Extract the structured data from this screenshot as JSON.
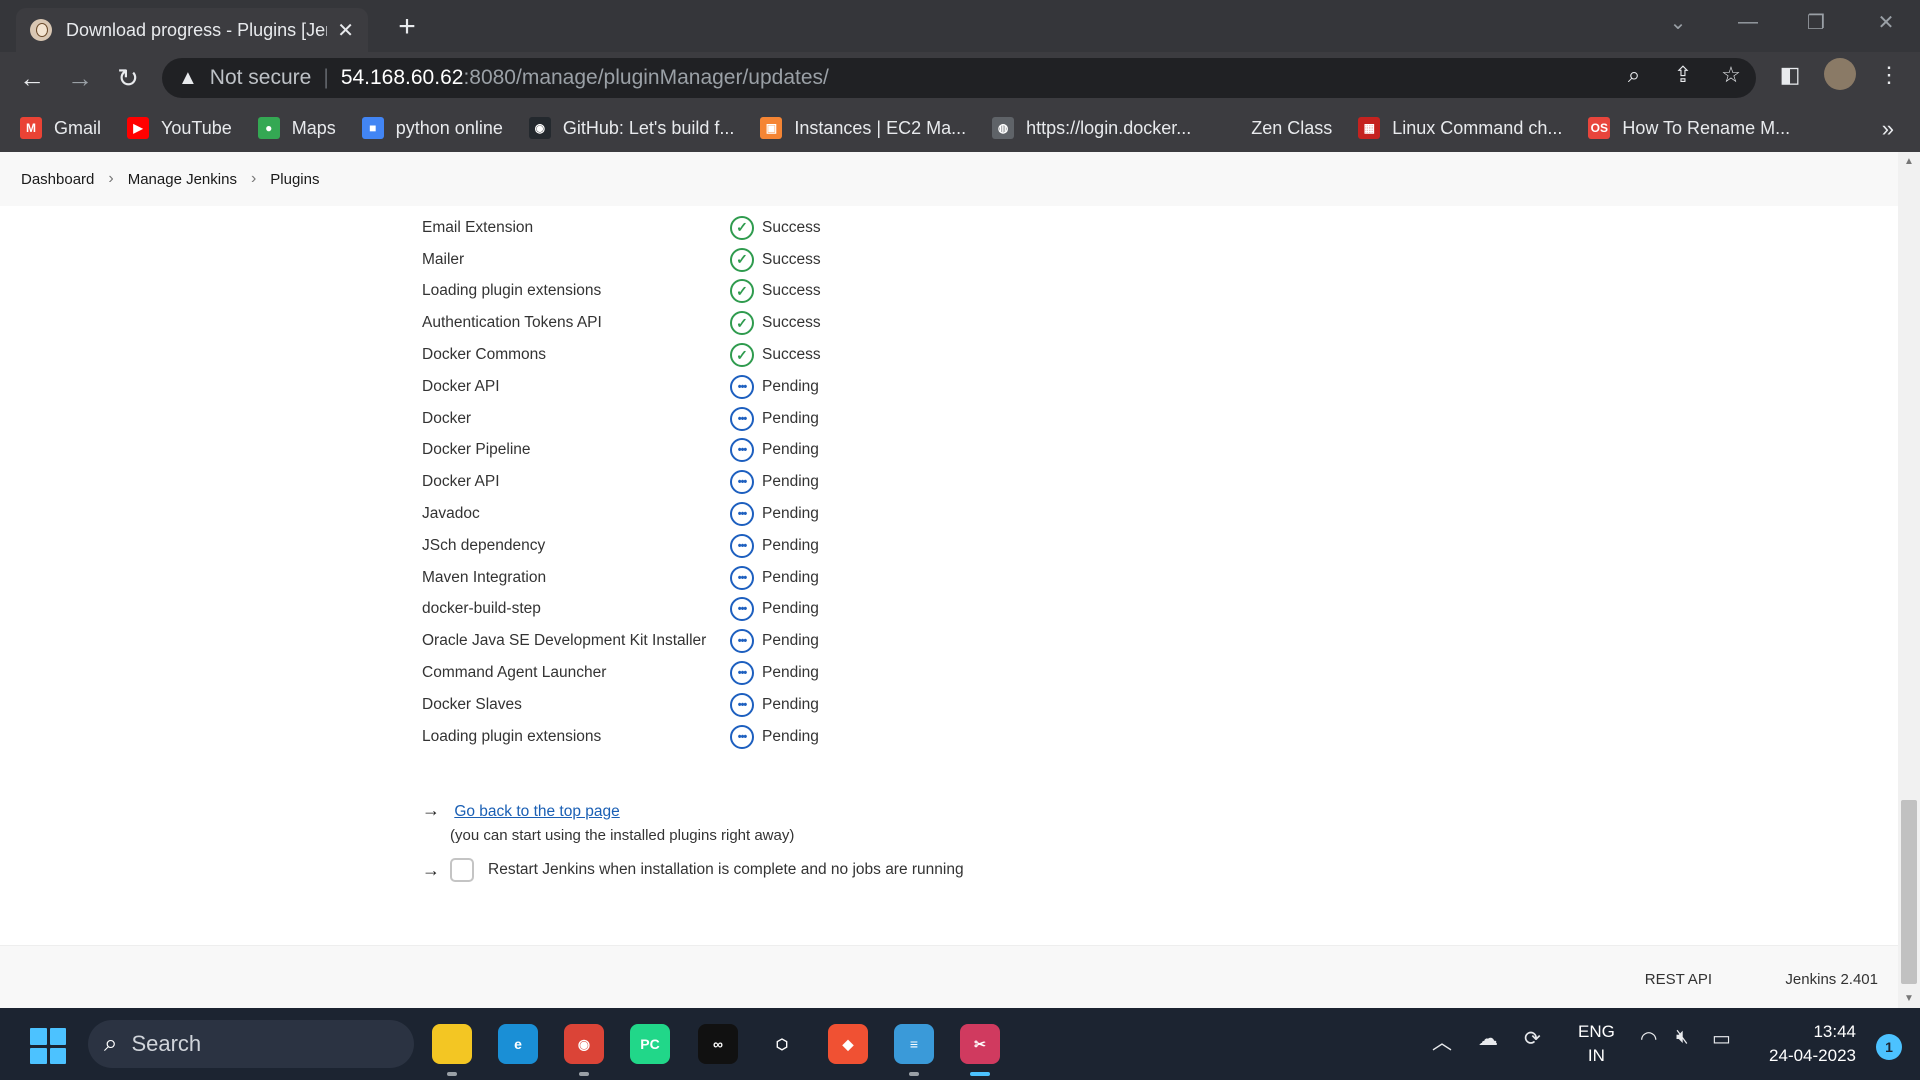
{
  "browser": {
    "tab_title": "Download progress - Plugins [Jenkins]",
    "address": {
      "security": "Not secure",
      "host": "54.168.60.62",
      "path": ":8080/manage/pluginManager/updates/"
    },
    "bookmarks": [
      {
        "label": "Gmail",
        "icon": "gmail-icon",
        "color": "#ea4335",
        "glyph": "M"
      },
      {
        "label": "YouTube",
        "icon": "youtube-icon",
        "color": "#ff0000",
        "glyph": "▶"
      },
      {
        "label": "Maps",
        "icon": "maps-icon",
        "color": "#34a853",
        "glyph": "●"
      },
      {
        "label": "python online",
        "icon": "python-online-icon",
        "color": "#4285f4",
        "glyph": "■"
      },
      {
        "label": "GitHub: Let's build f...",
        "icon": "github-icon",
        "color": "#24292e",
        "glyph": "◉"
      },
      {
        "label": "Instances | EC2 Ma...",
        "icon": "aws-ec2-icon",
        "color": "#f58534",
        "glyph": "▣"
      },
      {
        "label": "https://login.docker...",
        "icon": "globe-icon",
        "color": "#5f6368",
        "glyph": "◍"
      },
      {
        "label": "Zen Class",
        "icon": "zen-class-icon",
        "color": "#3c3c40",
        "glyph": ""
      },
      {
        "label": "Linux Command ch...",
        "icon": "linux-icon",
        "color": "#c5221f",
        "glyph": "▦"
      },
      {
        "label": "How To Rename M...",
        "icon": "os-icon",
        "color": "#e8453c",
        "glyph": "OS"
      }
    ]
  },
  "breadcrumb": [
    "Dashboard",
    "Manage Jenkins",
    "Plugins"
  ],
  "plugins": [
    {
      "name": "Email Extension",
      "status": "Success"
    },
    {
      "name": "Mailer",
      "status": "Success"
    },
    {
      "name": "Loading plugin extensions",
      "status": "Success"
    },
    {
      "name": "Authentication Tokens API",
      "status": "Success"
    },
    {
      "name": "Docker Commons",
      "status": "Success"
    },
    {
      "name": "Docker API",
      "status": "Pending"
    },
    {
      "name": "Docker",
      "status": "Pending"
    },
    {
      "name": "Docker Pipeline",
      "status": "Pending"
    },
    {
      "name": "Docker API",
      "status": "Pending"
    },
    {
      "name": "Javadoc",
      "status": "Pending"
    },
    {
      "name": "JSch dependency",
      "status": "Pending"
    },
    {
      "name": "Maven Integration",
      "status": "Pending"
    },
    {
      "name": "docker-build-step",
      "status": "Pending"
    },
    {
      "name": "Oracle Java SE Development Kit Installer",
      "status": "Pending"
    },
    {
      "name": "Command Agent Launcher",
      "status": "Pending"
    },
    {
      "name": "Docker Slaves",
      "status": "Pending"
    },
    {
      "name": "Loading plugin extensions",
      "status": "Pending"
    }
  ],
  "actions": {
    "top_page_link": "Go back to the top page",
    "top_page_note": "(you can start using the installed plugins right away)",
    "restart_label": "Restart Jenkins when installation is complete and no jobs are running",
    "restart_checked": false
  },
  "footer": {
    "rest_api": "REST API",
    "version": "Jenkins 2.401"
  },
  "colors": {
    "success": "#2f9b4e",
    "pending": "#1d5fbf",
    "link": "#1a5fb4"
  },
  "taskbar": {
    "search_label": "Search",
    "apps": [
      {
        "name": "file-explorer-icon",
        "color": "#f3c623",
        "glyph": ""
      },
      {
        "name": "edge-icon",
        "color": "#1a8fd6",
        "glyph": "e"
      },
      {
        "name": "chrome-icon",
        "color": "#db4437",
        "glyph": "◉"
      },
      {
        "name": "pycharm-icon",
        "color": "#21d789",
        "glyph": "PC"
      },
      {
        "name": "creative-cloud-icon",
        "color": "#111111",
        "glyph": "∞"
      },
      {
        "name": "virtualbox-icon",
        "color": "#1c2431",
        "glyph": "⬡"
      },
      {
        "name": "git-icon",
        "color": "#f05133",
        "glyph": "◆"
      },
      {
        "name": "notepad-icon",
        "color": "#3a9ad9",
        "glyph": "≡"
      },
      {
        "name": "snipping-tool-icon",
        "color": "#d03a5f",
        "glyph": "✂"
      }
    ],
    "language": [
      "ENG",
      "IN"
    ],
    "time": "13:44",
    "date": "24-04-2023",
    "notification_count": "1"
  }
}
